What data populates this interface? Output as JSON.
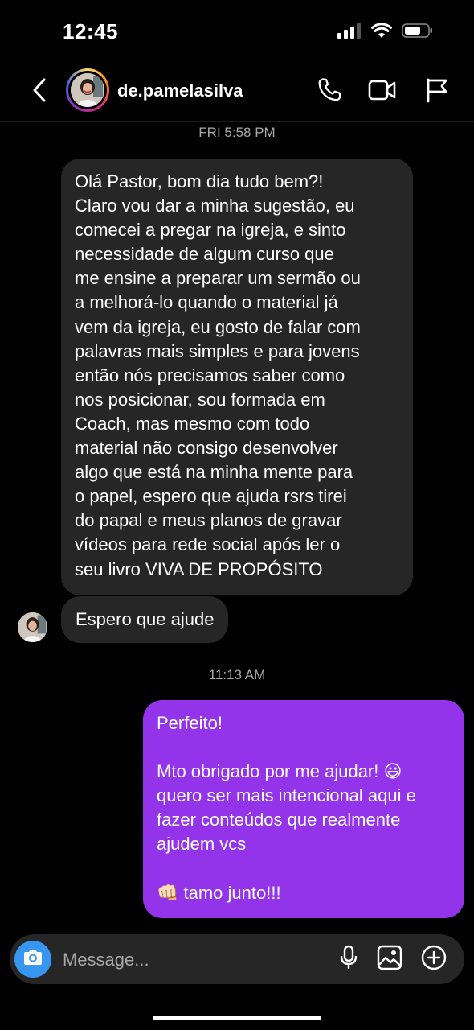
{
  "status_bar": {
    "time": "12:45"
  },
  "header": {
    "username": "de.pamelasilva"
  },
  "timestamps": {
    "first": "FRI 5:58 PM",
    "second": "11:13 AM"
  },
  "messages": {
    "incoming_long": "Olá Pastor, bom dia tudo bem?!\nClaro vou dar a minha sugestão, eu\ncomecei a pregar na igreja, e sinto\nnecessidade de algum curso que\nme ensine a preparar um sermão ou\na melhorá-lo quando o material já\nvem da igreja, eu gosto de falar com\npalavras mais simples e para jovens\nentão nós precisamos saber como\nnos posicionar, sou formada em\nCoach, mas mesmo com todo\nmaterial não consigo desenvolver\nalgo que está na minha mente para\no papel, espero que ajuda rsrs tirei\ndo papal e meus planos de gravar\nvídeos para rede social após ler o\nseu livro VIVA DE PROPÓSITO",
    "incoming_short": "Espero que ajude",
    "outgoing": "Perfeito!\n\nMto obrigado por me ajudar! 😃\nquero ser mais intencional aqui e\nfazer conteúdos que realmente\najudem vcs\n\n👊🏻 tamo junto!!!"
  },
  "composer": {
    "placeholder": "Message..."
  },
  "colors": {
    "outgoing_bubble": "#9333ea",
    "incoming_bubble": "#262626",
    "camera_button": "#3797f0"
  },
  "icons": [
    "back-chevron-icon",
    "phone-icon",
    "video-camera-icon",
    "flag-icon",
    "camera-icon",
    "microphone-icon",
    "gallery-icon",
    "plus-circle-icon"
  ]
}
